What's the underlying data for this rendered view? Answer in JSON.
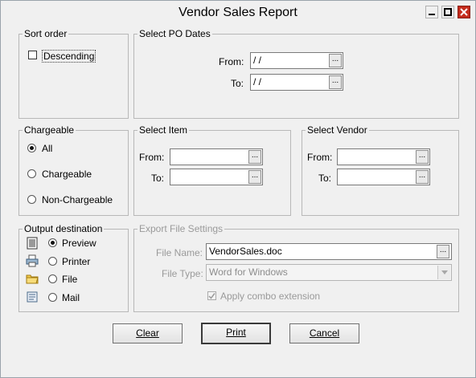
{
  "window": {
    "title": "Vendor Sales Report",
    "controls": [
      "minimize-icon",
      "maximize-icon",
      "close-icon"
    ]
  },
  "sort_order": {
    "legend": "Sort order",
    "descending_label": "Descending",
    "descending_checked": false
  },
  "po_dates": {
    "legend": "Select PO Dates",
    "from_label": "From:",
    "from_value": " / /",
    "to_label": "To:",
    "to_value": " / /",
    "browse_label": "..."
  },
  "chargeable": {
    "legend": "Chargeable",
    "options": [
      "All",
      "Chargeable",
      "Non-Chargeable"
    ],
    "selected": "All"
  },
  "select_item": {
    "legend": "Select Item",
    "from_label": "From:",
    "from_value": "",
    "to_label": "To:",
    "to_value": "",
    "browse_label": "..."
  },
  "select_vendor": {
    "legend": "Select Vendor",
    "from_label": "From:",
    "from_value": "",
    "to_label": "To:",
    "to_value": "",
    "browse_label": "..."
  },
  "output": {
    "legend": "Output destination",
    "options": [
      "Preview",
      "Printer",
      "File",
      "Mail"
    ],
    "icons": [
      "preview-icon",
      "printer-icon",
      "folder-icon",
      "mail-icon"
    ],
    "selected": "Preview"
  },
  "export": {
    "legend": "Export  File Settings",
    "file_name_label": "File Name:",
    "file_name_value": "VendorSales.doc",
    "browse_label": "...",
    "file_type_label": "File Type:",
    "file_type_value": "Word for Windows",
    "apply_label": "Apply combo extension",
    "apply_checked": true
  },
  "buttons": {
    "clear": "Clear",
    "print": "Print",
    "cancel": "Cancel"
  }
}
